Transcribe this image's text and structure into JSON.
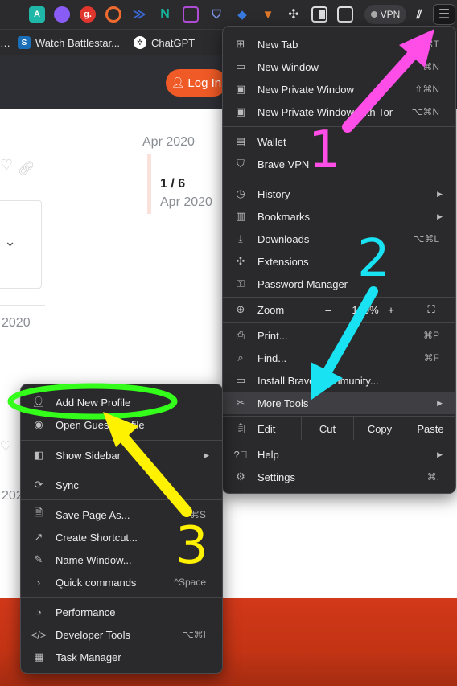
{
  "toolbar": {
    "extensions": [
      {
        "name": "A",
        "color": "#1fb8a8"
      },
      {
        "name": "",
        "color": "#8a5cf6"
      },
      {
        "name": "g.",
        "color": "#e0362d"
      },
      {
        "name": "",
        "color": "#ef6c2e"
      },
      {
        "name": "",
        "color": "#3b6bd8"
      },
      {
        "name": "N",
        "color": "#0e8a7a"
      },
      {
        "name": "",
        "color": "#b04bd6"
      },
      {
        "name": "",
        "color": "#5a77d6"
      },
      {
        "name": "",
        "color": "#3a7be0"
      },
      {
        "name": "",
        "color": "#e27a2a"
      },
      {
        "name": "",
        "color": "#9a9a9a"
      },
      {
        "name": "",
        "color": "#9a9a9a"
      },
      {
        "name": "",
        "color": "#9a9a9a"
      }
    ],
    "vpn_label": "VPN"
  },
  "bookmarks": [
    {
      "label": "Watch Battlestar...",
      "icon": "S"
    },
    {
      "label": "ChatGPT",
      "icon": "chatgpt-icon"
    }
  ],
  "site": {
    "login_label": "Log In",
    "date_top": "Apr 2020",
    "pager": "1 / 6",
    "pager_date": "Apr 2020",
    "left_date": "2020",
    "left_date2": "202"
  },
  "main_menu": {
    "items": {
      "new_tab": {
        "label": "New Tab",
        "shortcut": "⌘T"
      },
      "new_window": {
        "label": "New Window",
        "shortcut": "⌘N"
      },
      "new_private": {
        "label": "New Private Window",
        "shortcut": "⇧⌘N"
      },
      "new_private_tor": {
        "label": "New Private Window with Tor",
        "shortcut": "⌥⌘N"
      },
      "wallet": {
        "label": "Wallet"
      },
      "brave_vpn": {
        "label": "Brave VPN"
      },
      "history": {
        "label": "History"
      },
      "bookmarks": {
        "label": "Bookmarks"
      },
      "downloads": {
        "label": "Downloads",
        "shortcut": "⌥⌘L"
      },
      "extensions": {
        "label": "Extensions"
      },
      "password_manager": {
        "label": "Password Manager"
      },
      "zoom": {
        "label": "Zoom",
        "minus": "–",
        "value": "100%",
        "plus": "+"
      },
      "print": {
        "label": "Print...",
        "shortcut": "⌘P"
      },
      "find": {
        "label": "Find...",
        "shortcut": "⌘F"
      },
      "install": {
        "label": "Install Brave Community..."
      },
      "more_tools": {
        "label": "More Tools"
      },
      "edit": {
        "label": "Edit",
        "cut": "Cut",
        "copy": "Copy",
        "paste": "Paste"
      },
      "help": {
        "label": "Help"
      },
      "settings": {
        "label": "Settings",
        "shortcut": "⌘,"
      }
    }
  },
  "sub_menu": {
    "items": {
      "add_profile": {
        "label": "Add New Profile"
      },
      "open_guest": {
        "label": "Open Guest Profile"
      },
      "show_sidebar": {
        "label": "Show Sidebar"
      },
      "sync": {
        "label": "Sync"
      },
      "save_page": {
        "label": "Save Page As...",
        "shortcut": "⌘S"
      },
      "create_shortcut": {
        "label": "Create Shortcut..."
      },
      "name_window": {
        "label": "Name Window..."
      },
      "quick_commands": {
        "label": "Quick commands",
        "shortcut": "^Space"
      },
      "performance": {
        "label": "Performance"
      },
      "dev_tools": {
        "label": "Developer Tools",
        "shortcut": "⌥⌘I"
      },
      "task_manager": {
        "label": "Task Manager"
      }
    }
  },
  "annotations": {
    "step1": "1",
    "step2": "2",
    "step3": "3",
    "color1": "#ff4de8",
    "color2": "#19e3f2",
    "color3": "#fff200",
    "ellipse": "#33ff1a"
  }
}
